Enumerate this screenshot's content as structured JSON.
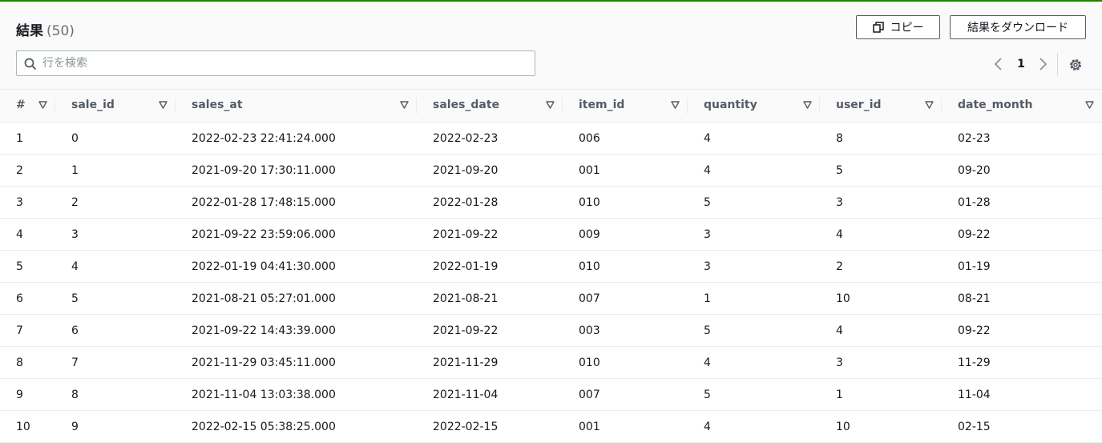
{
  "header": {
    "title": "結果",
    "count": "(50)",
    "copy_label": "コピー",
    "download_label": "結果をダウンロード"
  },
  "search": {
    "placeholder": "行を検索",
    "value": ""
  },
  "pagination": {
    "current_page": "1"
  },
  "table": {
    "columns": [
      "#",
      "sale_id",
      "sales_at",
      "sales_date",
      "item_id",
      "quantity",
      "user_id",
      "date_month"
    ],
    "rows": [
      [
        "1",
        "0",
        "2022-02-23 22:41:24.000",
        "2022-02-23",
        "006",
        "4",
        "8",
        "02-23"
      ],
      [
        "2",
        "1",
        "2021-09-20 17:30:11.000",
        "2021-09-20",
        "001",
        "4",
        "5",
        "09-20"
      ],
      [
        "3",
        "2",
        "2022-01-28 17:48:15.000",
        "2022-01-28",
        "010",
        "5",
        "3",
        "01-28"
      ],
      [
        "4",
        "3",
        "2021-09-22 23:59:06.000",
        "2021-09-22",
        "009",
        "3",
        "4",
        "09-22"
      ],
      [
        "5",
        "4",
        "2022-01-19 04:41:30.000",
        "2022-01-19",
        "010",
        "3",
        "2",
        "01-19"
      ],
      [
        "6",
        "5",
        "2021-08-21 05:27:01.000",
        "2021-08-21",
        "007",
        "1",
        "10",
        "08-21"
      ],
      [
        "7",
        "6",
        "2021-09-22 14:43:39.000",
        "2021-09-22",
        "003",
        "5",
        "4",
        "09-22"
      ],
      [
        "8",
        "7",
        "2021-11-29 03:45:11.000",
        "2021-11-29",
        "010",
        "4",
        "3",
        "11-29"
      ],
      [
        "9",
        "8",
        "2021-11-04 13:03:38.000",
        "2021-11-04",
        "007",
        "5",
        "1",
        "11-04"
      ],
      [
        "10",
        "9",
        "2022-02-15 05:38:25.000",
        "2022-02-15",
        "001",
        "4",
        "10",
        "02-15"
      ]
    ]
  },
  "colors": {
    "accent_green": "#1d8102",
    "header_bg": "#fafafa",
    "border": "#eaeded",
    "text": "#16191f",
    "muted": "#545b64"
  },
  "icons": [
    "copy-icon",
    "search-icon",
    "chevron-left-icon",
    "chevron-right-icon",
    "gear-icon",
    "sort-icon"
  ]
}
